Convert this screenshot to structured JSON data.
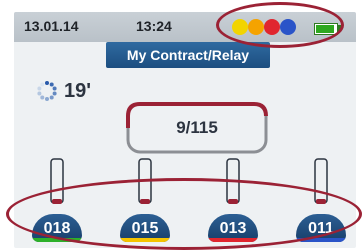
{
  "status": {
    "date": "13.01.14",
    "time": "13:24",
    "dot_colors": [
      "#f2d400",
      "#f5a300",
      "#e0262f",
      "#2a54c8"
    ],
    "battery_level": 0.9
  },
  "title": "My Contract/Relay",
  "timer": {
    "icon": "spinner-icon",
    "value": "19'"
  },
  "counter": {
    "value": "9/115",
    "progress_color": "#9b2235"
  },
  "lanes": [
    {
      "label": "018",
      "color": "#2db02a"
    },
    {
      "label": "015",
      "color": "#f5c400"
    },
    {
      "label": "013",
      "color": "#e0262f"
    },
    {
      "label": "011",
      "color": "#2a54c8"
    }
  ]
}
